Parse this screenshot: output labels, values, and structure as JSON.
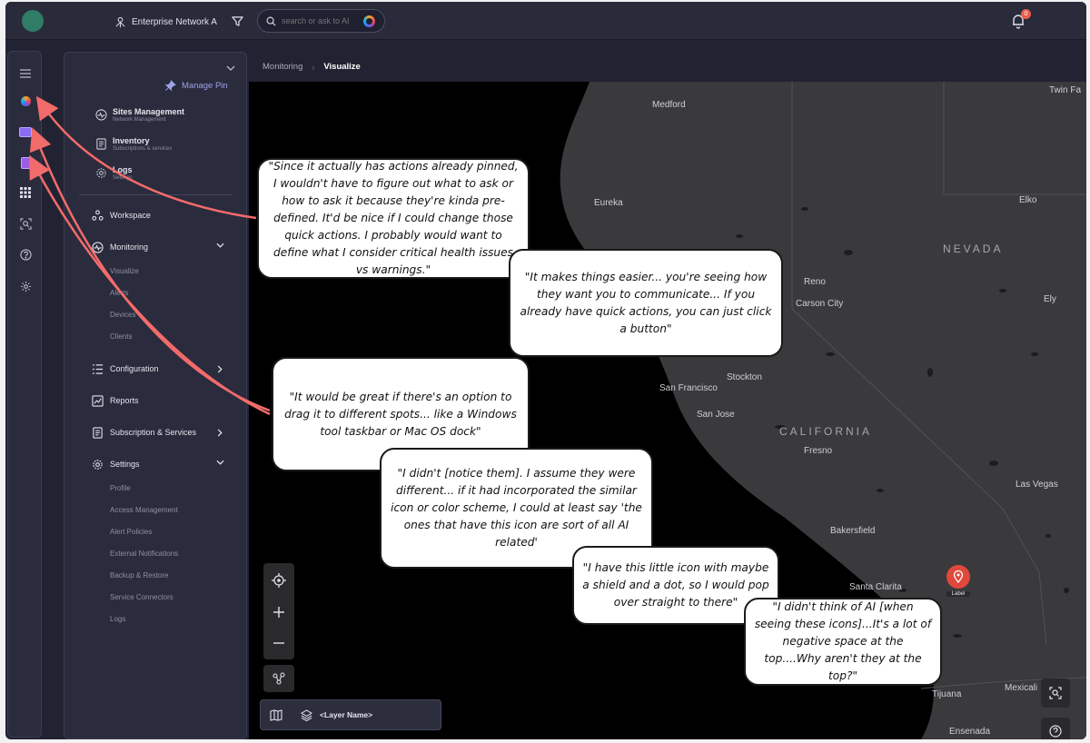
{
  "topbar": {
    "network_name": "Enterprise Network A",
    "search_placeholder": "search or ask to AI",
    "notification_count": "0"
  },
  "rail": {
    "icons": [
      "menu-icon",
      "ai-assistant-icon",
      "pinned-app-icon",
      "pinned-app-icon",
      "apps-grid-icon",
      "ai-search-icon",
      "help-icon",
      "settings-icon"
    ]
  },
  "nav": {
    "manage_pin": "Manage Pin",
    "pinned": [
      {
        "title": "Sites Management",
        "subtitle": "Network Management"
      },
      {
        "title": "Inventory",
        "subtitle": "Subscriptions & services"
      },
      {
        "title": "Logs",
        "subtitle": "Settings"
      }
    ],
    "workspace": "Workspace",
    "monitoring": "Monitoring",
    "monitoring_children": [
      "Visualize",
      "Alerts",
      "Devices",
      "Clients"
    ],
    "configuration": "Configuration",
    "reports": "Reports",
    "subscription": "Subscription & Services",
    "settings": "Settings",
    "settings_children": [
      "Profile",
      "Access Management",
      "Alert Policies",
      "External Notifications",
      "Backup & Restore",
      "Service Connectors",
      "Logs"
    ]
  },
  "breadcrumb": {
    "parent": "Monitoring",
    "current": "Visualize"
  },
  "map": {
    "cities": {
      "medford": "Medford",
      "twin_falls": "Twin Fa",
      "eureka": "Eureka",
      "elko": "Elko",
      "reno": "Reno",
      "carson_city": "Carson City",
      "ely": "Ely",
      "stockton": "Stockton",
      "san_francisco": "San Francisco",
      "san_jose": "San Jose",
      "fresno": "Fresno",
      "las_vegas": "Las Vegas",
      "bakersfield": "Bakersfield",
      "santa_clarita": "Santa Clarita",
      "tijuana": "Tijuana",
      "mexicali": "Mexicali",
      "ensenada": "Ensenada"
    },
    "states": {
      "nevada": "NEVADA",
      "california": "CALIFORNIA"
    },
    "marker_label": "Label",
    "layer_name": "<Layer Name>"
  },
  "quotes": [
    "\"Since it actually has actions already pinned, I wouldn't have to figure out what to ask or how to ask it because they're kinda pre-defined. It'd be nice if I could change those quick actions. I probably would want to define what I consider critical health issues vs warnings.\"",
    "\"It makes things easier... you're seeing how they want you to communicate... If you already have quick actions, you can just click a button\"",
    "\"It would be great if there's an option to drag it to different spots... like a Windows tool taskbar or Mac OS dock\"",
    "\"I didn't [notice them]. I assume they were different... if it had incorporated the similar icon or color scheme, I could at least say 'the ones that have this icon are sort of all AI related'",
    "\"I have this little icon with maybe a shield and a dot, so I would pop over straight to there\"",
    "\"I didn't think of AI [when seeing these icons]...It's a lot of negative space at the top....Why aren't they at the top?\""
  ],
  "colors": {
    "accent": "#9ea2e8",
    "arrow": "#f26b6b",
    "marker": "#e0483c",
    "avatar": "#2f7c67"
  }
}
